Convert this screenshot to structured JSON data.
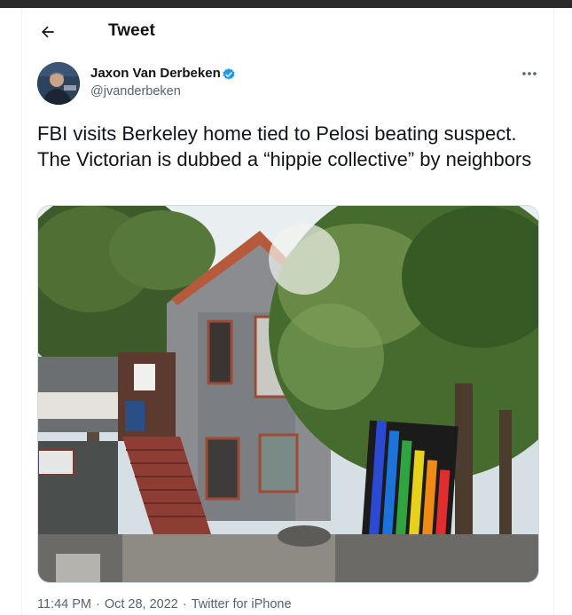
{
  "header": {
    "title": "Tweet",
    "back_icon": "arrow-left-icon"
  },
  "author": {
    "name": "Jaxon Van Derbeken",
    "handle": "@jvanderbeken",
    "verified": true,
    "verified_color": "#1d9bf0"
  },
  "tweet": {
    "text": "FBI visits Berkeley home tied to Pelosi beating suspect. The Victorian is dubbed a “hippie collective” by neighbors",
    "media_alt": "Photo of a Victorian house with trees and a rainbow flag"
  },
  "meta": {
    "time": "11:44 PM",
    "date": "Oct 28, 2022",
    "source": "Twitter for iPhone",
    "separator": "·"
  },
  "colors": {
    "text": "#0f1419",
    "secondary": "#536471",
    "accent": "#1d9bf0"
  }
}
